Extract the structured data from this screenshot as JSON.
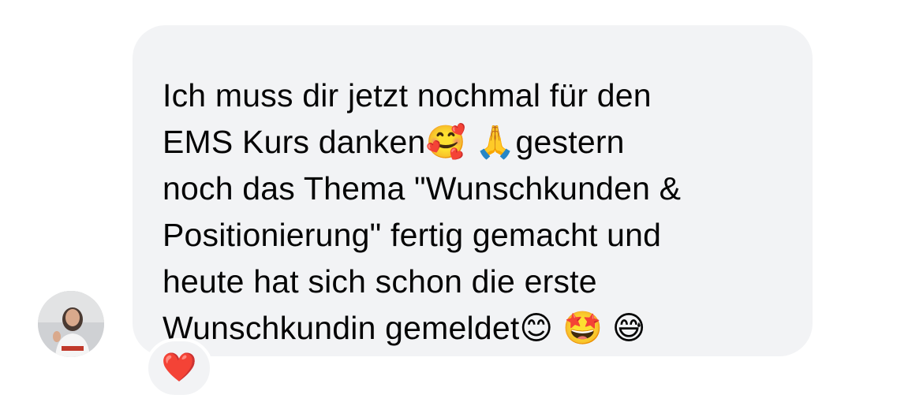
{
  "message": {
    "text": "Ich muss dir jetzt nochmal für den\nEMS Kurs danken🥰 🙏gestern\nnoch das Thema \"Wunschkunden &\nPositionierung\" fertig gemacht und\nheute hat sich schon die erste\nWunschkundin gemeldet😊 🤩 😅"
  },
  "reaction": {
    "emoji": "❤️"
  },
  "sender": {
    "avatar_icon": "profile-photo"
  },
  "colors": {
    "bubble_background": "#f2f3f5",
    "text": "#050505",
    "reaction_heart": "#e8202a"
  }
}
